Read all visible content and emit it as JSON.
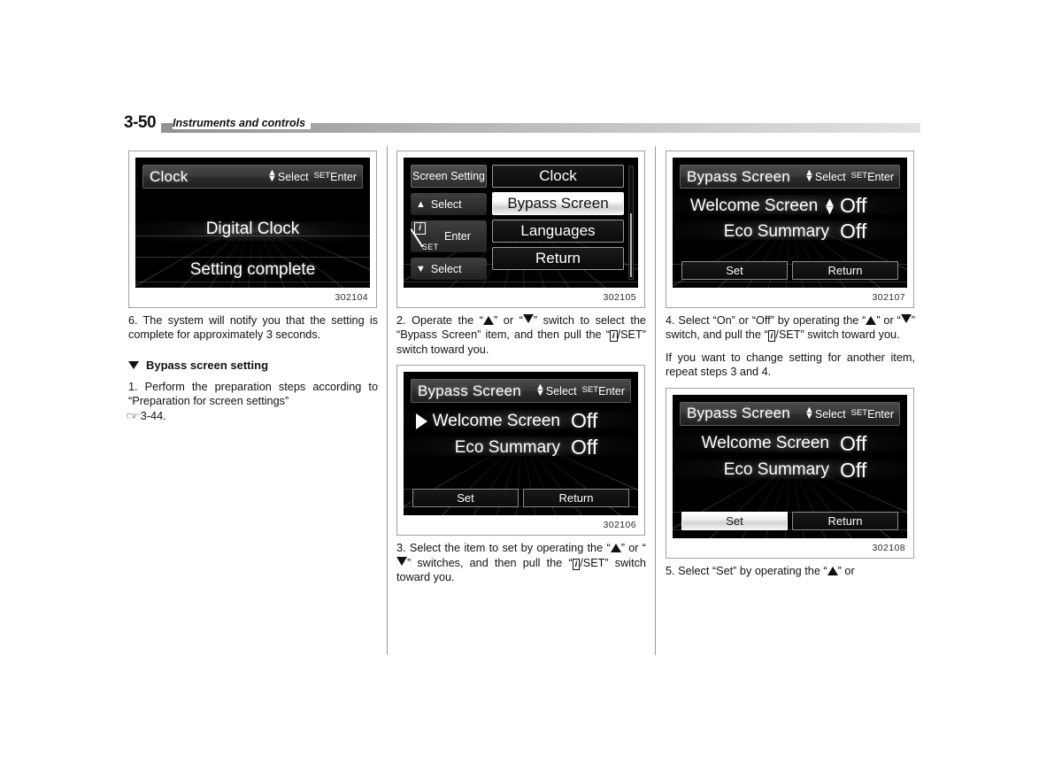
{
  "header": {
    "page_number": "3-50",
    "section_title": "Instruments and controls"
  },
  "columns": {
    "left": {
      "figure_1": {
        "caption": "302104",
        "title": "Clock",
        "hint_select": "Select",
        "hint_set": "SET",
        "hint_enter": "Enter",
        "line_1": "Digital Clock",
        "line_2": "Setting complete"
      },
      "step_6": "6. The system will notify you that the setting is complete for approximately 3 seconds.",
      "section_heading": "Bypass screen setting",
      "step_1_a": "1.  Perform the preparation steps according to “Preparation for screen settings”",
      "step_1_ref": "3-44."
    },
    "middle": {
      "figure_2": {
        "caption": "302105",
        "tag": "Screen Setting",
        "key_up": "Select",
        "key_enter": "Enter",
        "key_set": "SET",
        "key_i": "i",
        "key_down": "Select",
        "items": [
          {
            "label": "Clock",
            "selected": false
          },
          {
            "label": "Bypass Screen",
            "selected": true
          },
          {
            "label": "Languages",
            "selected": false
          },
          {
            "label": "Return",
            "selected": false
          }
        ]
      },
      "step_2_part1": "2.  Operate the “",
      "step_2_part2": "” or “",
      "step_2_part3": "” switch to select the “Bypass Screen” item, and then pull the “",
      "step_2_part4": "/SET” switch toward you.",
      "figure_3": {
        "caption": "302106",
        "title": "Bypass Screen",
        "hint_select": "Select",
        "hint_set": "SET",
        "hint_enter": "Enter",
        "rows": [
          {
            "label": "Welcome Screen",
            "value": "Off",
            "cursor": true,
            "updown": false
          },
          {
            "label": "Eco Summary",
            "value": "Off",
            "cursor": false,
            "updown": false
          }
        ],
        "button_set": "Set",
        "button_return": "Return",
        "set_selected": false
      },
      "step_3_part1": "3.  Select the item to set by operating the “",
      "step_3_part2": "” or “",
      "step_3_part3": "” switches, and then pull the “",
      "step_3_part4": "/SET” switch toward you."
    },
    "right": {
      "figure_4": {
        "caption": "302107",
        "title": "Bypass Screen",
        "hint_select": "Select",
        "hint_set": "SET",
        "hint_enter": "Enter",
        "rows": [
          {
            "label": "Welcome Screen",
            "value": "Off",
            "cursor": false,
            "updown": true
          },
          {
            "label": "Eco Summary",
            "value": "Off",
            "cursor": false,
            "updown": false
          }
        ],
        "button_set": "Set",
        "button_return": "Return",
        "set_selected": false
      },
      "step_4_part1": "4.  Select “On” or “Off” by operating the “",
      "step_4_part2": "” or “",
      "step_4_part3": "” switch, and pull the “",
      "step_4_part4": "/SET” switch toward you.",
      "step_4_note": "If you want to change setting for another item, repeat steps 3 and 4.",
      "figure_5": {
        "caption": "302108",
        "title": "Bypass Screen",
        "hint_select": "Select",
        "hint_set": "SET",
        "hint_enter": "Enter",
        "rows": [
          {
            "label": "Welcome Screen",
            "value": "Off",
            "cursor": false,
            "updown": false
          },
          {
            "label": "Eco Summary",
            "value": "Off",
            "cursor": false,
            "updown": false
          }
        ],
        "button_set": "Set",
        "button_return": "Return",
        "set_selected": true
      },
      "step_5_part1": "5.  Select “Set” by operating the “",
      "step_5_part2": "” or"
    }
  },
  "icon_names": {
    "triangle_up": "triangle-up-icon",
    "triangle_down": "triangle-down-icon",
    "info": "info-icon",
    "pointer": "pointing-hand-icon"
  }
}
